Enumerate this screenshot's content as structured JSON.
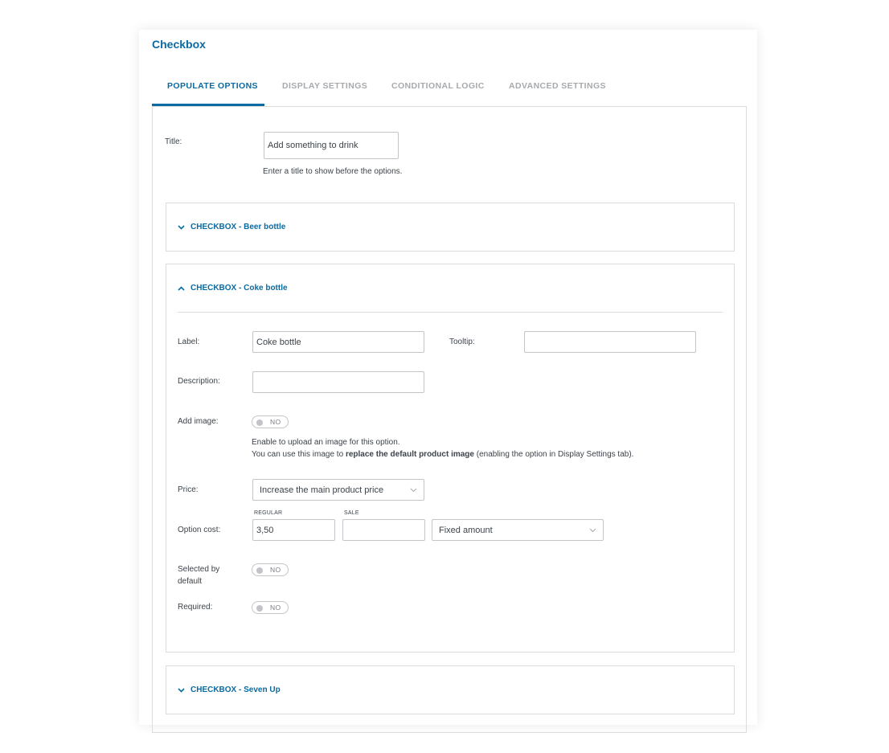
{
  "panel": {
    "title": "Checkbox"
  },
  "tabs": [
    {
      "label": "POPULATE OPTIONS",
      "active": true
    },
    {
      "label": "DISPLAY SETTINGS",
      "active": false
    },
    {
      "label": "CONDITIONAL LOGIC",
      "active": false
    },
    {
      "label": "ADVANCED SETTINGS",
      "active": false
    }
  ],
  "title_field": {
    "label": "Title:",
    "value": "Add something to drink",
    "help": "Enter a title to show before the options."
  },
  "accordions": [
    {
      "title": "CHECKBOX - Beer bottle",
      "expanded": false
    },
    {
      "title": "CHECKBOX - Coke bottle",
      "expanded": true
    },
    {
      "title": "CHECKBOX - Seven Up",
      "expanded": false
    }
  ],
  "option": {
    "label_label": "Label:",
    "label_value": "Coke bottle",
    "tooltip_label": "Tooltip:",
    "tooltip_value": "",
    "description_label": "Description:",
    "description_value": "",
    "add_image_label": "Add image:",
    "add_image_state": "NO",
    "add_image_help_1": "Enable to upload an image for this option.",
    "add_image_help_2_pre": "You can use this image to",
    "add_image_help_2_bold": "replace the default product image",
    "add_image_help_2_post": "(enabling the option in Display Settings tab).",
    "price_label": "Price:",
    "price_value": "Increase the main product price",
    "option_cost_label": "Option cost:",
    "regular_label": "REGULAR",
    "regular_value": "3,50",
    "sale_label": "SALE",
    "sale_value": "",
    "cost_type_value": "Fixed amount",
    "selected_label_1": "Selected by",
    "selected_label_2": "default",
    "selected_state": "NO",
    "required_label": "Required:",
    "required_state": "NO"
  },
  "icons": {
    "expand": "chevron-down-icon",
    "collapse": "chevron-up-icon",
    "select": "chevron-down-icon"
  },
  "colors": {
    "accent": "#0a6aa1",
    "border": "#dcdcde",
    "muted": "#a7aaad"
  }
}
